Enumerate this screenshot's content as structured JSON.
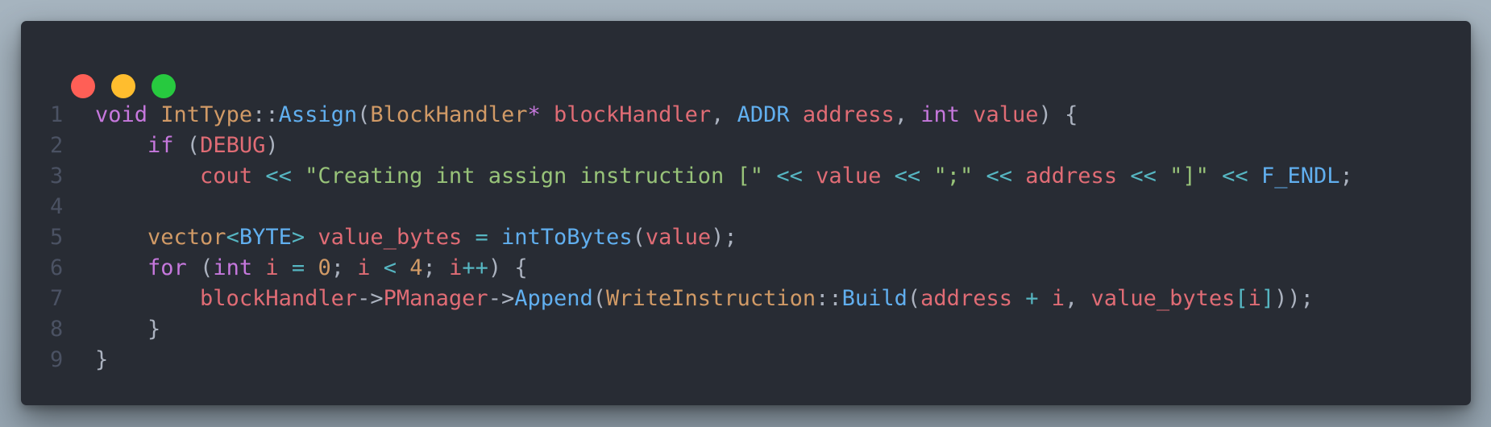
{
  "window": {
    "controls": {
      "close_color": "#ff5f56",
      "minimize_color": "#ffbd2e",
      "maximize_color": "#27c93f"
    }
  },
  "editor": {
    "language": "C++",
    "lines": [
      {
        "number": "1",
        "tokens": [
          {
            "text": "void",
            "kind": "kw"
          },
          {
            "text": " ",
            "kind": "pun"
          },
          {
            "text": "IntType",
            "kind": "ty2"
          },
          {
            "text": "::",
            "kind": "pun"
          },
          {
            "text": "Assign",
            "kind": "fn"
          },
          {
            "text": "(",
            "kind": "pun"
          },
          {
            "text": "BlockHandler",
            "kind": "ty2"
          },
          {
            "text": "*",
            "kind": "kw"
          },
          {
            "text": " ",
            "kind": "pun"
          },
          {
            "text": "blockHandler",
            "kind": "var"
          },
          {
            "text": ", ",
            "kind": "pun"
          },
          {
            "text": "ADDR",
            "kind": "fn"
          },
          {
            "text": " ",
            "kind": "pun"
          },
          {
            "text": "address",
            "kind": "var"
          },
          {
            "text": ", ",
            "kind": "pun"
          },
          {
            "text": "int",
            "kind": "kw"
          },
          {
            "text": " ",
            "kind": "pun"
          },
          {
            "text": "value",
            "kind": "var"
          },
          {
            "text": ") {",
            "kind": "pun"
          }
        ]
      },
      {
        "number": "2",
        "tokens": [
          {
            "text": "    ",
            "kind": "pun"
          },
          {
            "text": "if",
            "kind": "kw"
          },
          {
            "text": " (",
            "kind": "pun"
          },
          {
            "text": "DEBUG",
            "kind": "var"
          },
          {
            "text": ")",
            "kind": "pun"
          }
        ]
      },
      {
        "number": "3",
        "tokens": [
          {
            "text": "        ",
            "kind": "pun"
          },
          {
            "text": "cout",
            "kind": "var"
          },
          {
            "text": " ",
            "kind": "pun"
          },
          {
            "text": "<<",
            "kind": "op"
          },
          {
            "text": " ",
            "kind": "pun"
          },
          {
            "text": "\"Creating int assign instruction [\"",
            "kind": "str"
          },
          {
            "text": " ",
            "kind": "pun"
          },
          {
            "text": "<<",
            "kind": "op"
          },
          {
            "text": " ",
            "kind": "pun"
          },
          {
            "text": "value",
            "kind": "var"
          },
          {
            "text": " ",
            "kind": "pun"
          },
          {
            "text": "<<",
            "kind": "op"
          },
          {
            "text": " ",
            "kind": "pun"
          },
          {
            "text": "\";\"",
            "kind": "str"
          },
          {
            "text": " ",
            "kind": "pun"
          },
          {
            "text": "<<",
            "kind": "op"
          },
          {
            "text": " ",
            "kind": "pun"
          },
          {
            "text": "address",
            "kind": "var"
          },
          {
            "text": " ",
            "kind": "pun"
          },
          {
            "text": "<<",
            "kind": "op"
          },
          {
            "text": " ",
            "kind": "pun"
          },
          {
            "text": "\"]\"",
            "kind": "str"
          },
          {
            "text": " ",
            "kind": "pun"
          },
          {
            "text": "<<",
            "kind": "op"
          },
          {
            "text": " ",
            "kind": "pun"
          },
          {
            "text": "F_ENDL",
            "kind": "fn"
          },
          {
            "text": ";",
            "kind": "pun"
          }
        ]
      },
      {
        "number": "4",
        "tokens": []
      },
      {
        "number": "5",
        "tokens": [
          {
            "text": "    ",
            "kind": "pun"
          },
          {
            "text": "vector",
            "kind": "ty2"
          },
          {
            "text": "<",
            "kind": "op"
          },
          {
            "text": "BYTE",
            "kind": "fn"
          },
          {
            "text": ">",
            "kind": "op"
          },
          {
            "text": " ",
            "kind": "pun"
          },
          {
            "text": "value_bytes",
            "kind": "var"
          },
          {
            "text": " ",
            "kind": "pun"
          },
          {
            "text": "=",
            "kind": "op"
          },
          {
            "text": " ",
            "kind": "pun"
          },
          {
            "text": "intToBytes",
            "kind": "fn"
          },
          {
            "text": "(",
            "kind": "pun"
          },
          {
            "text": "value",
            "kind": "var"
          },
          {
            "text": ");",
            "kind": "pun"
          }
        ]
      },
      {
        "number": "6",
        "tokens": [
          {
            "text": "    ",
            "kind": "pun"
          },
          {
            "text": "for",
            "kind": "kw"
          },
          {
            "text": " (",
            "kind": "pun"
          },
          {
            "text": "int",
            "kind": "kw"
          },
          {
            "text": " ",
            "kind": "pun"
          },
          {
            "text": "i",
            "kind": "var"
          },
          {
            "text": " ",
            "kind": "pun"
          },
          {
            "text": "=",
            "kind": "op"
          },
          {
            "text": " ",
            "kind": "pun"
          },
          {
            "text": "0",
            "kind": "num"
          },
          {
            "text": "; ",
            "kind": "pun"
          },
          {
            "text": "i",
            "kind": "var"
          },
          {
            "text": " ",
            "kind": "pun"
          },
          {
            "text": "<",
            "kind": "op"
          },
          {
            "text": " ",
            "kind": "pun"
          },
          {
            "text": "4",
            "kind": "num"
          },
          {
            "text": "; ",
            "kind": "pun"
          },
          {
            "text": "i",
            "kind": "var"
          },
          {
            "text": "++",
            "kind": "op"
          },
          {
            "text": ") {",
            "kind": "pun"
          }
        ]
      },
      {
        "number": "7",
        "tokens": [
          {
            "text": "        ",
            "kind": "pun"
          },
          {
            "text": "blockHandler",
            "kind": "var"
          },
          {
            "text": "->",
            "kind": "pun"
          },
          {
            "text": "PManager",
            "kind": "var"
          },
          {
            "text": "->",
            "kind": "pun"
          },
          {
            "text": "Append",
            "kind": "fn"
          },
          {
            "text": "(",
            "kind": "pun"
          },
          {
            "text": "WriteInstruction",
            "kind": "ty2"
          },
          {
            "text": "::",
            "kind": "pun"
          },
          {
            "text": "Build",
            "kind": "fn"
          },
          {
            "text": "(",
            "kind": "pun"
          },
          {
            "text": "address",
            "kind": "var"
          },
          {
            "text": " ",
            "kind": "pun"
          },
          {
            "text": "+",
            "kind": "op"
          },
          {
            "text": " ",
            "kind": "pun"
          },
          {
            "text": "i",
            "kind": "var"
          },
          {
            "text": ", ",
            "kind": "pun"
          },
          {
            "text": "value_bytes",
            "kind": "var"
          },
          {
            "text": "[",
            "kind": "op"
          },
          {
            "text": "i",
            "kind": "var"
          },
          {
            "text": "]",
            "kind": "op"
          },
          {
            "text": "));",
            "kind": "pun"
          }
        ]
      },
      {
        "number": "8",
        "tokens": [
          {
            "text": "    }",
            "kind": "pun"
          }
        ]
      },
      {
        "number": "9",
        "tokens": [
          {
            "text": "}",
            "kind": "pun"
          }
        ]
      }
    ]
  }
}
